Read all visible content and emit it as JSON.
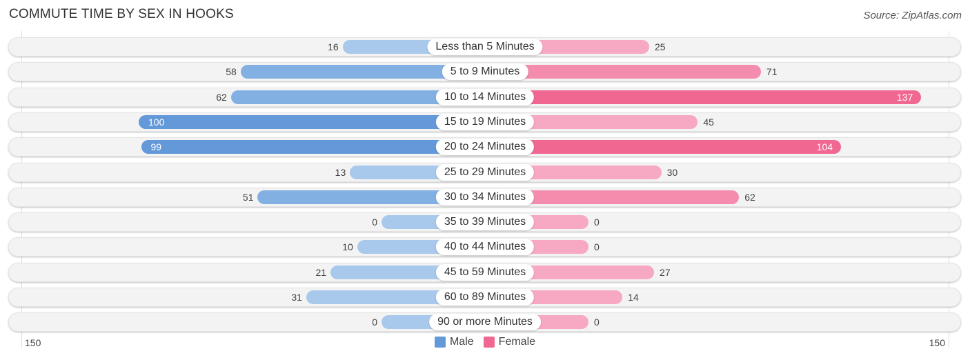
{
  "header": {
    "title": "COMMUTE TIME BY SEX IN HOOKS",
    "source": "Source: ZipAtlas.com"
  },
  "colors": {
    "male_dark": "#6399d9",
    "male_light": "#a9c9ec",
    "female_dark": "#f06892",
    "female_light": "#f7a8c2"
  },
  "chart_data": {
    "type": "bar",
    "orientation": "horizontal-diverging",
    "title": "COMMUTE TIME BY SEX IN HOOKS",
    "categories": [
      "Less than 5 Minutes",
      "5 to 9 Minutes",
      "10 to 14 Minutes",
      "15 to 19 Minutes",
      "20 to 24 Minutes",
      "25 to 29 Minutes",
      "30 to 34 Minutes",
      "35 to 39 Minutes",
      "40 to 44 Minutes",
      "45 to 59 Minutes",
      "60 to 89 Minutes",
      "90 or more Minutes"
    ],
    "series": [
      {
        "name": "Male",
        "values": [
          16,
          58,
          62,
          100,
          99,
          13,
          51,
          0,
          10,
          21,
          31,
          0
        ]
      },
      {
        "name": "Female",
        "values": [
          25,
          71,
          137,
          45,
          104,
          30,
          62,
          0,
          0,
          27,
          14,
          0
        ]
      }
    ],
    "axis": {
      "left_label": "150",
      "right_label": "150",
      "max": 150
    },
    "legend": {
      "position": "bottom-center",
      "items": [
        "Male",
        "Female"
      ]
    }
  }
}
